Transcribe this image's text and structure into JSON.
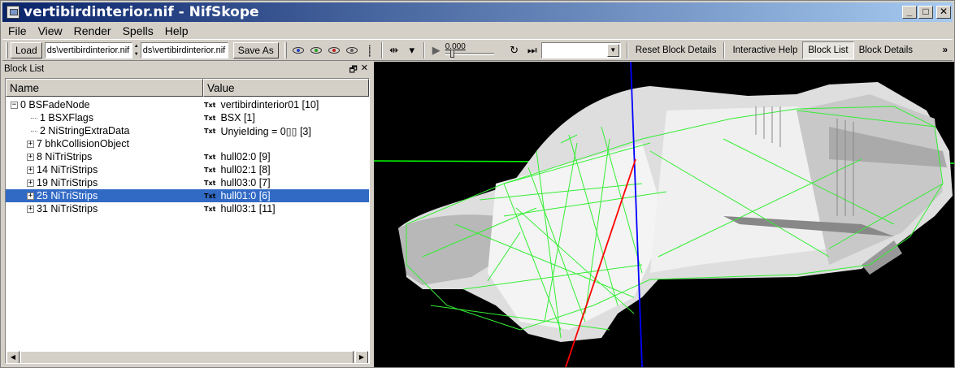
{
  "window": {
    "title": "vertibirdinterior.nif - NifSkope",
    "min_btn": "_",
    "max_btn": "□",
    "close_btn": "✕"
  },
  "menu": {
    "file": "File",
    "view": "View",
    "render": "Render",
    "spells": "Spells",
    "help": "Help"
  },
  "toolbar": {
    "load_label": "Load",
    "load_path": "ds\\vertibirdinterior.nif",
    "save_path": "ds\\vertibirdinterior.nif",
    "save_as_label": "Save As",
    "time_value": "0.000",
    "reset_block_details": "Reset Block Details",
    "interactive_help": "Interactive Help",
    "block_list": "Block List",
    "block_details": "Block Details",
    "overflow": "»"
  },
  "block_list": {
    "title": "Block List",
    "float_btn": "🗗",
    "close_btn": "✕",
    "col_name": "Name",
    "col_value": "Value",
    "type_tag": "Txt",
    "rows": [
      {
        "name": "0 BSFadeNode",
        "value": "vertibirdinterior01 [10]"
      },
      {
        "name": "1 BSXFlags",
        "value": "BSX [1]"
      },
      {
        "name": "2 NiStringExtraData",
        "value": "UnyieIding = 0▯▯ [3]"
      },
      {
        "name": "7 bhkCollisionObject",
        "value": ""
      },
      {
        "name": "8 NiTriStrips",
        "value": "hull02:0 [9]"
      },
      {
        "name": "14 NiTriStrips",
        "value": "hull02:1 [8]"
      },
      {
        "name": "19 NiTriStrips",
        "value": "hull03:0 [7]"
      },
      {
        "name": "25 NiTriStrips",
        "value": "hull01:0 [6]"
      },
      {
        "name": "31 NiTriStrips",
        "value": "hull03:1 [11]"
      }
    ],
    "selected_index": 7
  },
  "colors": {
    "titlebar_start": "#0a246a",
    "titlebar_end": "#a6caf0",
    "selection": "#316ac5",
    "viewport_bg": "#000000",
    "axis_green": "#00ff00",
    "axis_blue": "#0000ff",
    "axis_red": "#ff0000",
    "mesh_white": "#e8e8e8"
  }
}
